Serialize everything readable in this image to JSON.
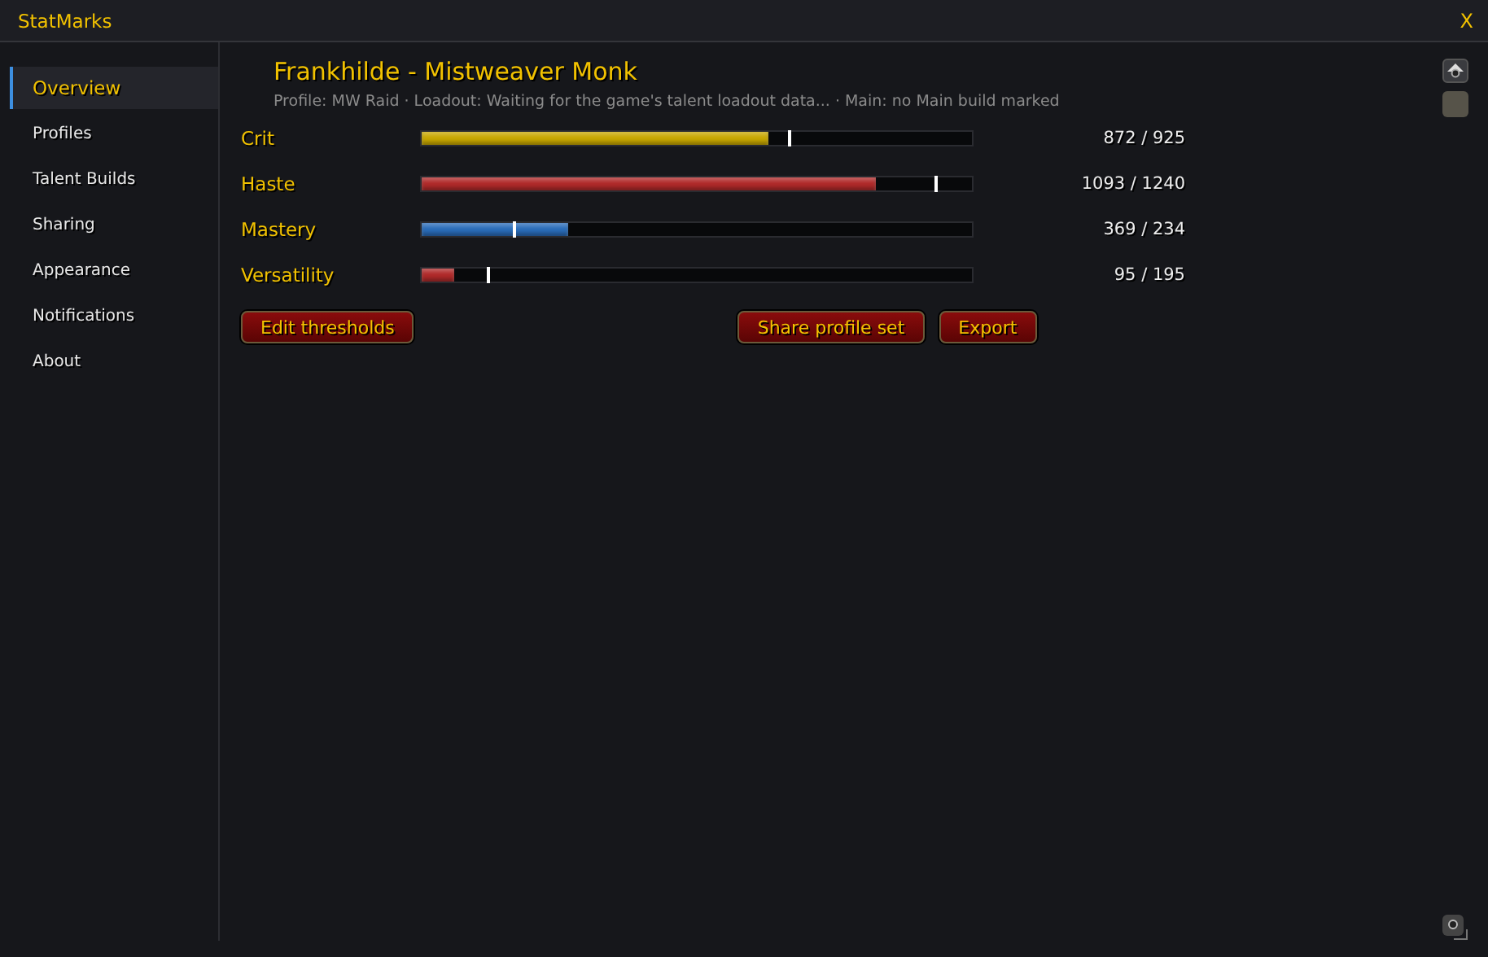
{
  "window": {
    "title": "StatMarks",
    "close": "X"
  },
  "sidebar": {
    "items": [
      {
        "label": "Overview",
        "selected": true
      },
      {
        "label": "Profiles",
        "selected": false
      },
      {
        "label": "Talent Builds",
        "selected": false
      },
      {
        "label": "Sharing",
        "selected": false
      },
      {
        "label": "Appearance",
        "selected": false
      },
      {
        "label": "Notifications",
        "selected": false
      },
      {
        "label": "About",
        "selected": false
      }
    ]
  },
  "header": {
    "title": "Frankhilde - Mistweaver Monk",
    "subtitle": "Profile: MW Raid · Loadout: Waiting for the game's talent loadout data... · Main: no Main build marked"
  },
  "stats": [
    {
      "name": "Crit",
      "level": 0.63,
      "color": "#c9a800",
      "threshold": {
        "level": 0.668
      },
      "reading": "872 / 925"
    },
    {
      "name": "Haste",
      "level": 0.826,
      "color": "#b02a2a",
      "threshold": {
        "level": 0.935
      },
      "reading": "1093 / 1240"
    },
    {
      "name": "Mastery",
      "level": 0.265,
      "color": "#2a6cb8",
      "threshold": {
        "level": 0.17
      },
      "reading": "369 / 234"
    },
    {
      "name": "Versatility",
      "level": 0.06,
      "color": "#b02a2a",
      "threshold": {
        "level": 0.12
      },
      "reading": "95 / 195"
    }
  ],
  "buttons": {
    "left": [
      "Edit thresholds"
    ],
    "right": [
      "Share profile set",
      "Export"
    ]
  }
}
